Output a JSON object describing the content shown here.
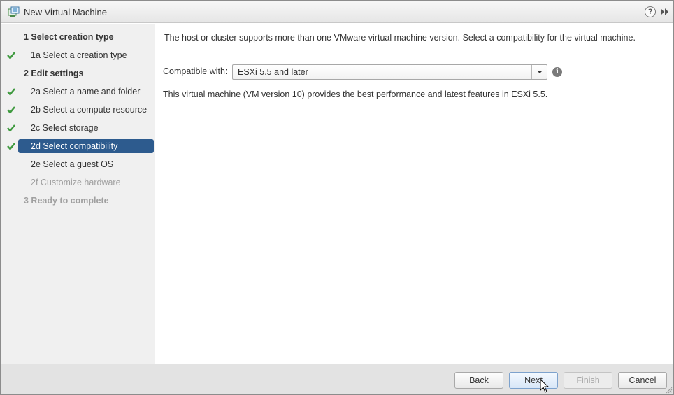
{
  "window": {
    "title": "New Virtual Machine",
    "icon": "vm-wizard-icon"
  },
  "nav": {
    "items": [
      {
        "label": "1  Select creation type",
        "checked": false,
        "state": "bold"
      },
      {
        "label": "1a  Select a creation type",
        "checked": true,
        "state": "sub"
      },
      {
        "label": "2  Edit settings",
        "checked": false,
        "state": "bold"
      },
      {
        "label": "2a  Select a name and folder",
        "checked": true,
        "state": "sub"
      },
      {
        "label": "2b  Select a compute resource",
        "checked": true,
        "state": "sub"
      },
      {
        "label": "2c  Select storage",
        "checked": true,
        "state": "sub"
      },
      {
        "label": "2d  Select compatibility",
        "checked": true,
        "state": "selected"
      },
      {
        "label": "2e  Select a guest OS",
        "checked": false,
        "state": "sub"
      },
      {
        "label": "2f  Customize hardware",
        "checked": false,
        "state": "disabled"
      },
      {
        "label": "3  Ready to complete",
        "checked": false,
        "state": "bold-disabled"
      }
    ]
  },
  "main": {
    "description": "The host or cluster supports more than one VMware virtual machine version. Select a compatibility for the virtual machine.",
    "compat_label": "Compatible with:",
    "compat_value": "ESXi 5.5 and later",
    "vm_info": "This virtual machine (VM version 10) provides the best performance and latest features in ESXi 5.5."
  },
  "footer": {
    "back": "Back",
    "next": "Next",
    "finish": "Finish",
    "cancel": "Cancel"
  },
  "colors": {
    "selected_bg": "#2d5b8e",
    "check_green": "#3f9a3f"
  }
}
